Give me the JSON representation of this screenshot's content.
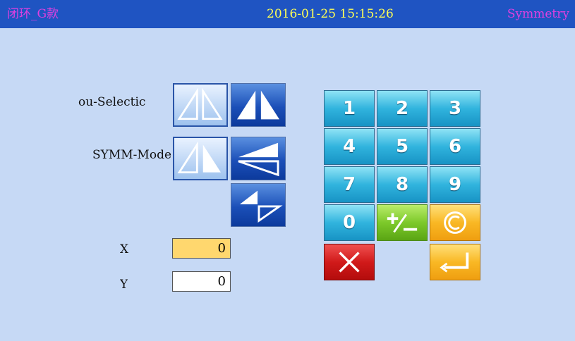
{
  "titlebar": {
    "app_name": "闭环_G款",
    "datetime": "2016-01-25 15:15:26",
    "screen": "Symmetry"
  },
  "options": {
    "object_selection_label": "ou-Selectic",
    "symm_mode_label": "SYMM-Mode"
  },
  "inputs": {
    "x_label": "X",
    "x_value": "0",
    "y_label": "Y",
    "y_value": "0"
  },
  "keypad": {
    "k1": "1",
    "k2": "2",
    "k3": "3",
    "k4": "4",
    "k5": "5",
    "k6": "6",
    "k7": "7",
    "k8": "8",
    "k9": "9",
    "k0": "0"
  },
  "colors": {
    "titlebar": "#1f54c2",
    "background": "#c6d9f5",
    "active_field": "#ffd76e"
  }
}
